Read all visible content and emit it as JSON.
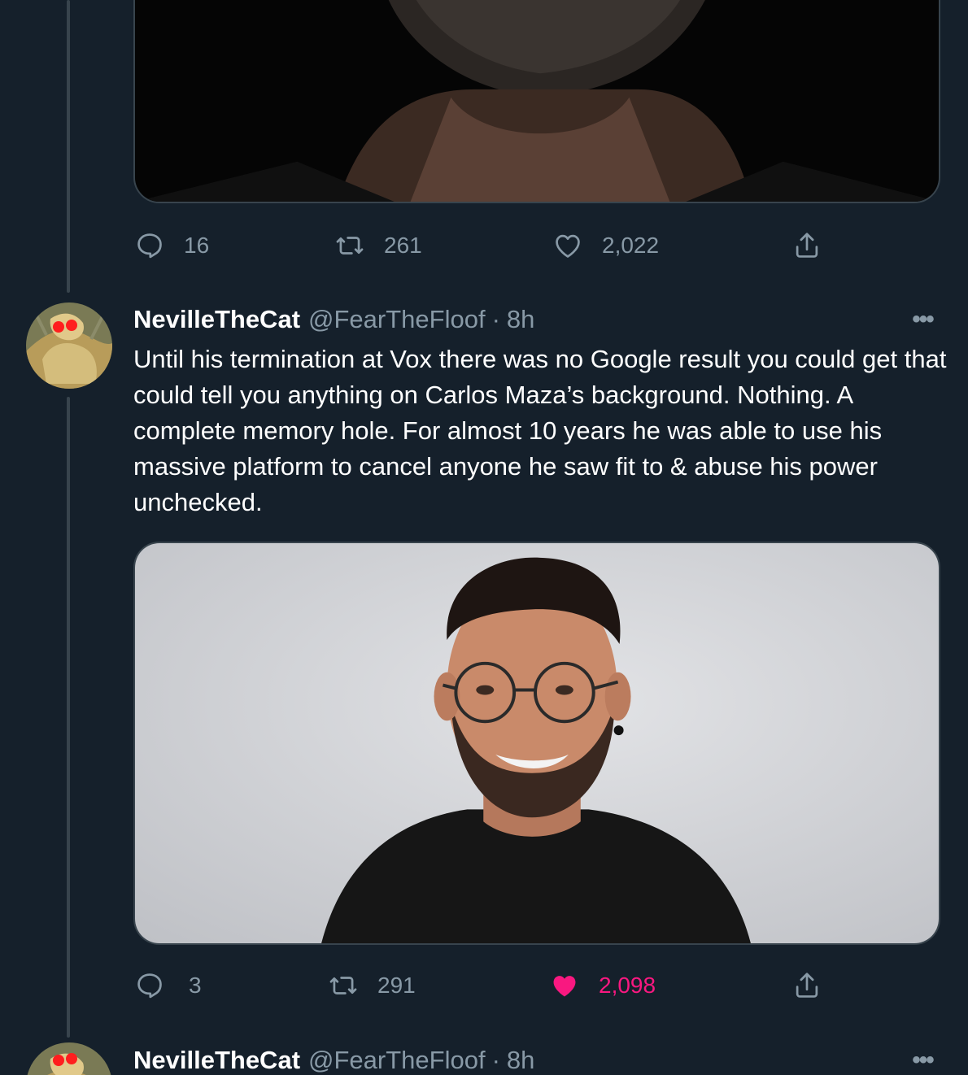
{
  "tweet_prev": {
    "actions": {
      "reply_count": "16",
      "retweet_count": "261",
      "like_count": "2,022"
    }
  },
  "tweet_main": {
    "display_name": "NevilleTheCat",
    "handle": "@FearTheFloof",
    "separator": "·",
    "time": "8h",
    "more_label": "•••",
    "text": "Until his termination at Vox there was no Google result you could get that could tell you anything on Carlos Maza’s background. Nothing. A complete memory hole. For almost 10 years he was able to use his massive platform to cancel anyone he saw fit to & abuse his power unchecked.",
    "actions": {
      "reply_count": "3",
      "retweet_count": "291",
      "like_count": "2,098",
      "liked": true
    }
  },
  "tweet_next": {
    "display_name": "NevilleTheCat",
    "handle": "@FearTheFloof",
    "separator": "·",
    "time": "8h",
    "more_label": "•••"
  },
  "colors": {
    "background": "#15202b",
    "muted_text": "#8899a6",
    "like_pink": "#f91880",
    "border": "#38444d"
  },
  "icons": [
    "reply-icon",
    "retweet-icon",
    "like-icon",
    "share-icon",
    "more-icon"
  ]
}
